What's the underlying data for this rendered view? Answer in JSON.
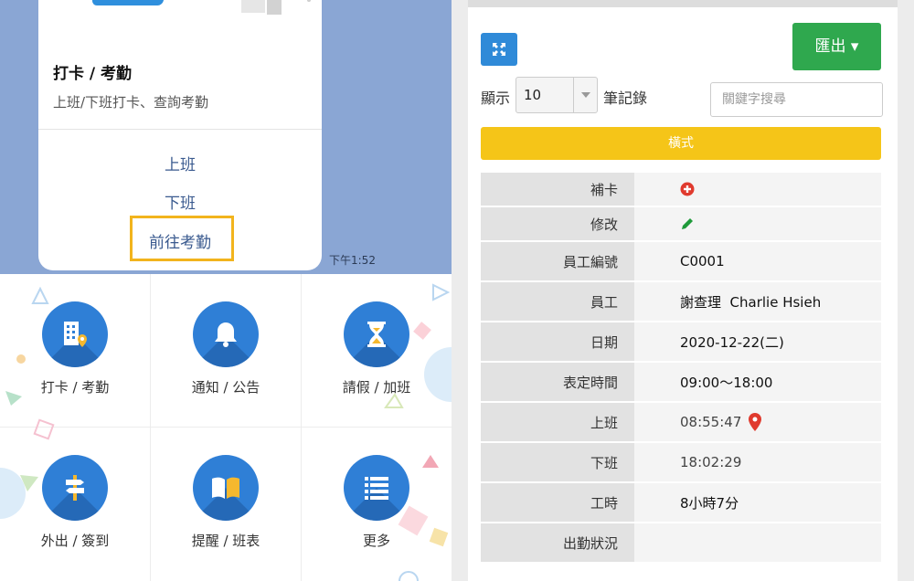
{
  "chat": {
    "card": {
      "title": "打卡 / 考勤",
      "description": "上班/下班打卡、查詢考勤",
      "actions": [
        "上班",
        "下班",
        "前往考勤"
      ]
    },
    "time": "下午1:52"
  },
  "menu": {
    "items": [
      {
        "label": "打卡 / 考勤",
        "icon": "building-location-icon"
      },
      {
        "label": "通知 / 公告",
        "icon": "bell-icon"
      },
      {
        "label": "請假 / 加班",
        "icon": "hourglass-icon"
      },
      {
        "label": "外出 / 簽到",
        "icon": "signpost-icon"
      },
      {
        "label": "提醒 / 班表",
        "icon": "book-icon"
      },
      {
        "label": "更多",
        "icon": "list-icon"
      }
    ]
  },
  "toolbar": {
    "expand_icon": "expand-icon",
    "export_label": "匯出 ▾",
    "show_label": "顯示",
    "page_size": "10",
    "records_label": "筆記錄",
    "search_placeholder": "關鍵字搜尋",
    "mode_label": "橫式"
  },
  "record": {
    "rows": [
      {
        "label": "補卡",
        "value": "",
        "icon": "plus-circle-icon"
      },
      {
        "label": "修改",
        "value": "",
        "icon": "pencil-icon"
      },
      {
        "label": "員工編號",
        "value": "C0001"
      },
      {
        "label": "員工",
        "value": "謝查理  Charlie Hsieh"
      },
      {
        "label": "日期",
        "value": "2020-12-22(二)"
      },
      {
        "label": "表定時間",
        "value": "09:00～18:00"
      },
      {
        "label": "上班",
        "value": "08:55:47",
        "icon": "map-pin-icon"
      },
      {
        "label": "下班",
        "value": "18:02:29"
      },
      {
        "label": "工時",
        "value": "8小時7分"
      },
      {
        "label": "出勤狀況",
        "value": ""
      }
    ]
  },
  "colors": {
    "primary_blue": "#2f7fd6",
    "export_green": "#2fa84e",
    "mode_yellow": "#f5c518",
    "highlight": "#f2b41d",
    "chat_bg": "#8aa6d4"
  }
}
